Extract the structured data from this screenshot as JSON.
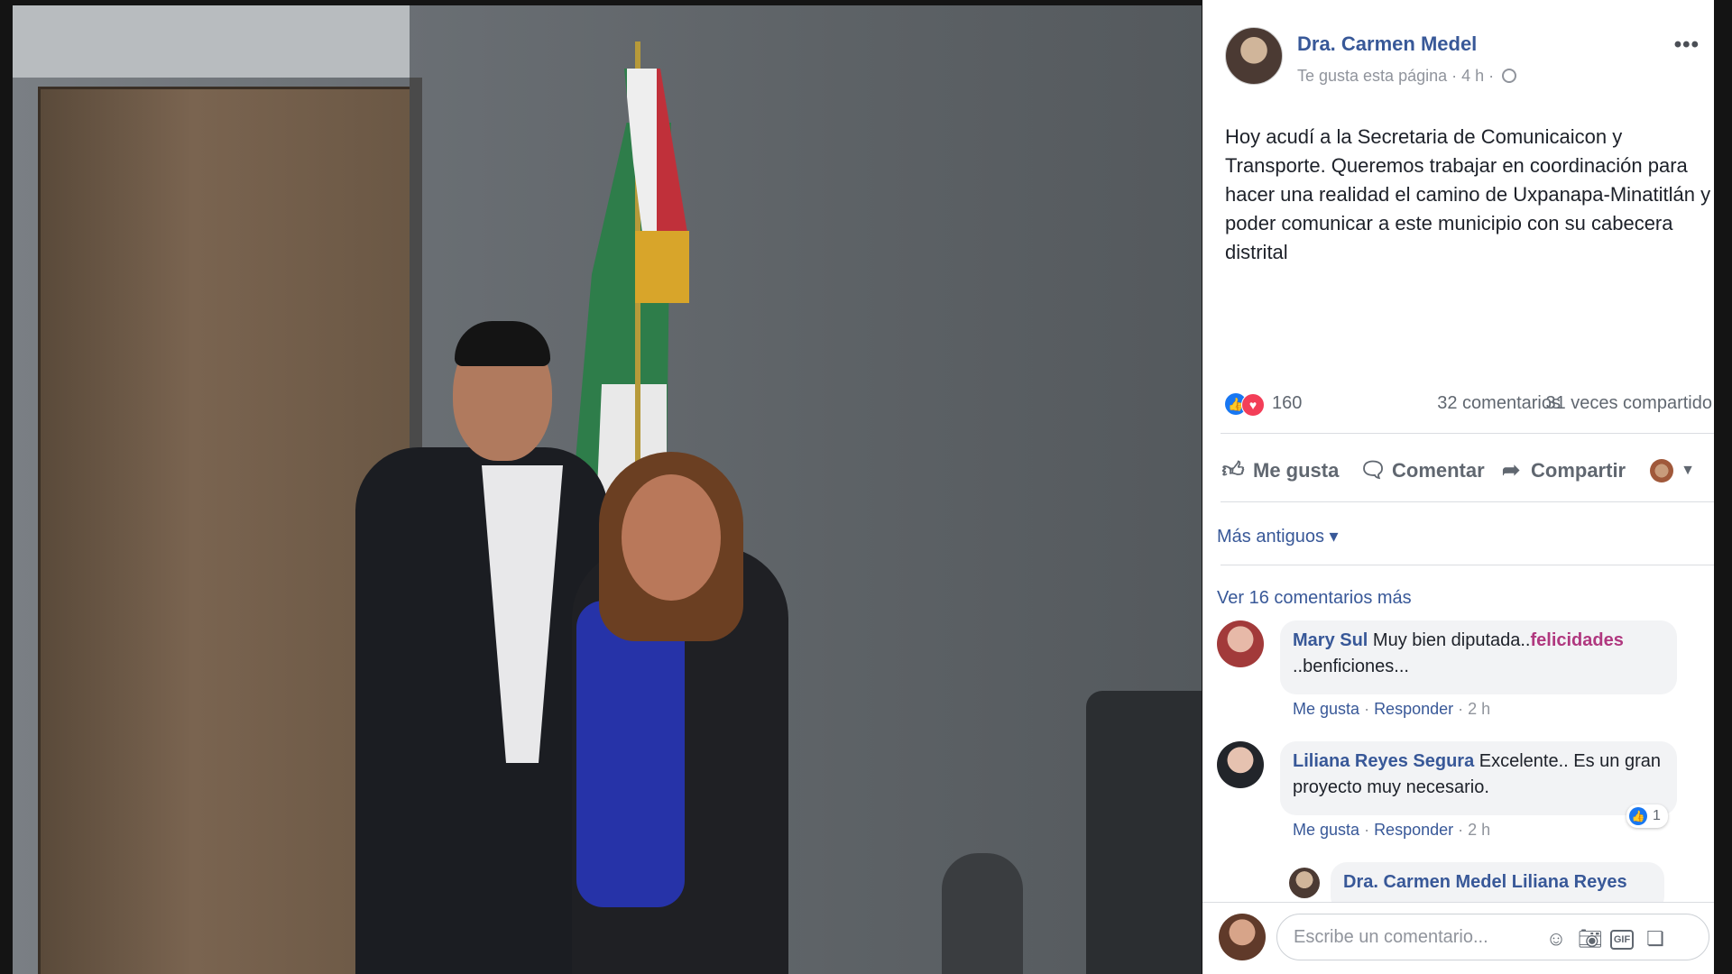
{
  "post": {
    "author": "Dra. Carmen Medel",
    "meta": "Te gusta esta página · 4 h ·",
    "more": "•••",
    "text": "Hoy acudí a la Secretaria de Comunicaicon y Transporte. Queremos trabajar en coordinación para hacer una realidad el camino de Uxpanapa-Minatitlán y poder comunicar a este municipio con su cabecera distrital"
  },
  "stats": {
    "reactions": "160",
    "comments": "32 comentarios",
    "shares": "31 veces compartido"
  },
  "actions": {
    "like": "Me gusta",
    "comment": "Comentar",
    "share": "Compartir"
  },
  "sort": "Más antiguos ▾",
  "view_more": "Ver 16 comentarios más",
  "comments": [
    {
      "author": "Mary Sul",
      "text": "Muy bien diputada..",
      "highlight": "felicidades",
      "text2": "..benficiones...",
      "like": "Me gusta",
      "reply": "Responder",
      "time": "2 h"
    },
    {
      "author": "Liliana Reyes Segura",
      "text": "Excelente.. Es un gran proyecto muy necesario.",
      "like": "Me gusta",
      "reply": "Responder",
      "time": "2 h",
      "reactions": "1"
    }
  ],
  "reply": {
    "author": "Dra. Carmen Medel",
    "text": "Liliana Reyes"
  },
  "composer": {
    "placeholder": "Escribe un comentario..."
  },
  "icons": [
    "globe-icon",
    "more-options-icon",
    "like-reaction-icon",
    "love-reaction-icon",
    "thumbs-up-icon",
    "comment-icon",
    "share-icon",
    "emoji-icon",
    "camera-icon",
    "gif-icon",
    "sticker-icon"
  ]
}
